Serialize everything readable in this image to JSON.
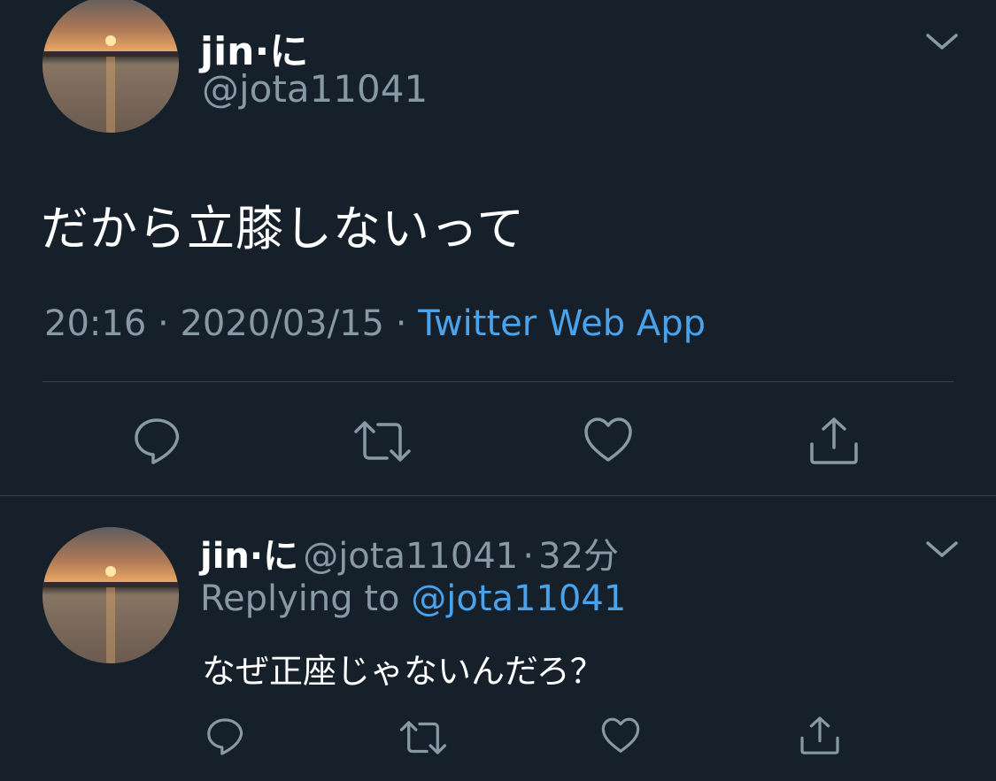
{
  "main_tweet": {
    "display_name": "jin·に",
    "handle": "@jota11041",
    "text": "だから立膝しないって",
    "time": "20:16",
    "separator": "·",
    "date": "2020/03/15",
    "source": "Twitter Web App"
  },
  "reply_tweet": {
    "display_name": "jin·に",
    "handle": "@jota11041",
    "separator": "·",
    "age": "32分",
    "replying_prefix": "Replying to",
    "replying_to": "@jota11041",
    "text": "なぜ正座じゃないんだろ？"
  },
  "icons": {
    "caret": "chevron-down-icon",
    "reply": "reply-icon",
    "retweet": "retweet-icon",
    "like": "heart-icon",
    "share": "share-icon"
  },
  "colors": {
    "background": "#15202b",
    "secondary_text": "#8899a6",
    "link": "#4aa3ea",
    "divider": "#38444d"
  }
}
